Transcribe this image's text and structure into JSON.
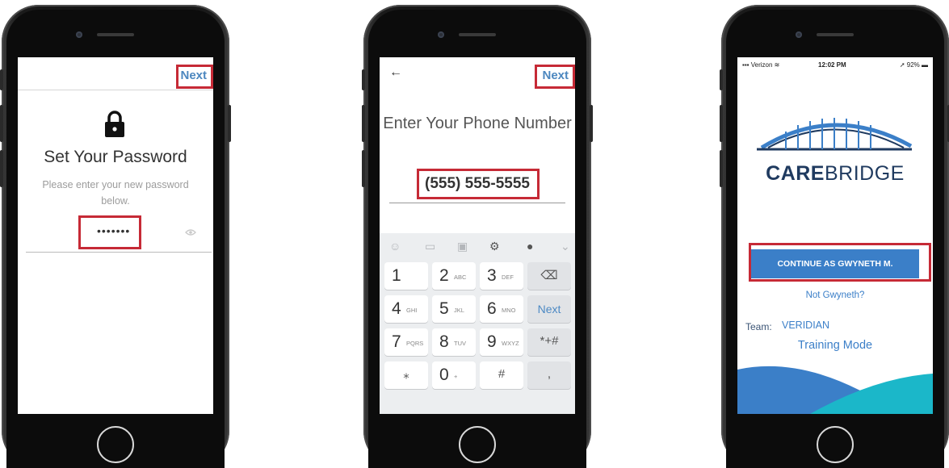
{
  "phone1": {
    "next_label": "Next",
    "title": "Set Your Password",
    "subtitle": "Please enter your new password below.",
    "password_value": "•••••••",
    "icons": [
      "lock-icon",
      "eye-icon"
    ]
  },
  "phone2": {
    "next_label": "Next",
    "back_glyph": "←",
    "title": "Enter Your Phone Number",
    "phone_value": "(555) 555-5555",
    "keyboard": {
      "toolbar_icons": [
        "emoji-icon",
        "sticker-icon",
        "gif-icon",
        "settings-icon",
        "microphone-icon",
        "chevron-down-icon"
      ],
      "keys": [
        {
          "num": "1",
          "letters": ""
        },
        {
          "num": "2",
          "letters": "ABC"
        },
        {
          "num": "3",
          "letters": "DEF"
        },
        {
          "label": "⌫"
        },
        {
          "num": "4",
          "letters": "GHI"
        },
        {
          "num": "5",
          "letters": "JKL"
        },
        {
          "num": "6",
          "letters": "MNO"
        },
        {
          "label": "Next"
        },
        {
          "num": "7",
          "letters": "PQRS"
        },
        {
          "num": "8",
          "letters": "TUV"
        },
        {
          "num": "9",
          "letters": "WXYZ"
        },
        {
          "label": "*+#"
        },
        {
          "label": "⁎"
        },
        {
          "num": "0",
          "letters": "+"
        },
        {
          "label": "#"
        },
        {
          "label": ","
        }
      ]
    }
  },
  "phone3": {
    "status": {
      "carrier": "Verizon",
      "time": "12:02 PM",
      "battery": "92%"
    },
    "brand_bold": "CARE",
    "brand_light": "BRIDGE",
    "continue_label": "CONTINUE AS GWYNETH M.",
    "not_user": "Not Gwyneth?",
    "team_label": "Team:",
    "team_value": "VERIDIAN",
    "mode": "Training Mode"
  },
  "colors": {
    "accent": "#3b7fc8",
    "highlight": "#c62a36",
    "next": "#4c87bf"
  }
}
